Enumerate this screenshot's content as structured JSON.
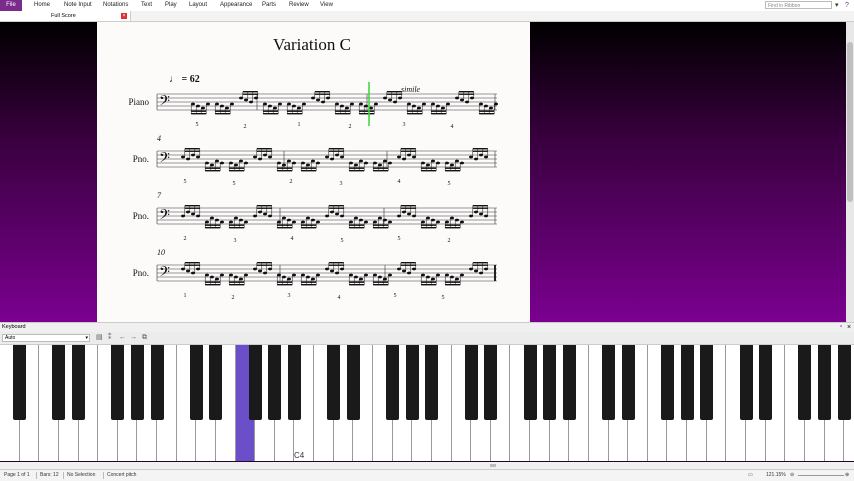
{
  "menubar": {
    "file": "File",
    "items": [
      "Home",
      "Note Input",
      "Notations",
      "Text",
      "Play",
      "Layout",
      "Appearance",
      "Parts",
      "Review",
      "View"
    ],
    "search_placeholder": "Find in Ribbon"
  },
  "tabs": [
    {
      "label": "Full Score"
    }
  ],
  "score": {
    "title": "Variation C",
    "tempo": "♩ = 62",
    "simile": "simile",
    "systems": [
      {
        "label": "Piano",
        "measure_number": "",
        "fingerings": [
          "5",
          "2",
          "1",
          "2",
          "3",
          "4"
        ]
      },
      {
        "label": "Pno.",
        "measure_number": "4",
        "fingerings": [
          "5",
          "5",
          "2",
          "3",
          "4",
          "5"
        ]
      },
      {
        "label": "Pno.",
        "measure_number": "7",
        "fingerings": [
          "2",
          "3",
          "4",
          "5",
          "5",
          "2"
        ]
      },
      {
        "label": "Pno.",
        "measure_number": "10",
        "fingerings": [
          "1",
          "2",
          "3",
          "4",
          "5",
          "5"
        ]
      }
    ]
  },
  "keyboard_panel": {
    "title": "Keyboard",
    "mode": "Auto",
    "key_label": "C4"
  },
  "status": {
    "page": "Page 1 of 1",
    "bars": "Bars: 12",
    "selection": "No Selection",
    "pitch": "Concert pitch",
    "zoom": "121.15%"
  },
  "colors": {
    "accent": "#7a2c8c",
    "key_highlight": "#6a4fc8",
    "playhead": "#35d635"
  }
}
